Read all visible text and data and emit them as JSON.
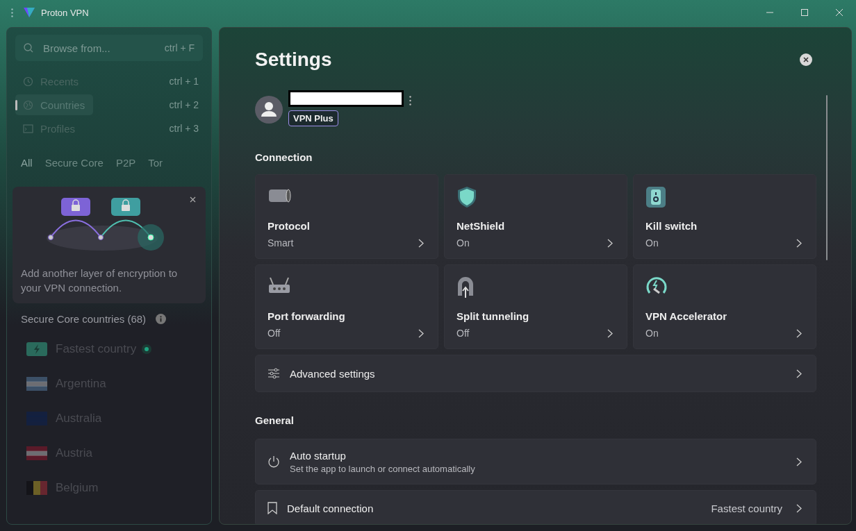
{
  "window": {
    "title": "Proton VPN"
  },
  "sidebar": {
    "search": {
      "placeholder": "Browse from...",
      "shortcut": "ctrl + F"
    },
    "nav": [
      {
        "label": "Recents",
        "shortcut": "ctrl + 1",
        "selected": false
      },
      {
        "label": "Countries",
        "shortcut": "ctrl + 2",
        "selected": true
      },
      {
        "label": "Profiles",
        "shortcut": "ctrl + 3",
        "selected": false
      }
    ],
    "filters": [
      {
        "label": "All",
        "selected": true
      },
      {
        "label": "Secure Core",
        "selected": false
      },
      {
        "label": "P2P",
        "selected": false
      },
      {
        "label": "Tor",
        "selected": false
      }
    ],
    "promo": {
      "text": "Add another layer of encryption to your VPN connection."
    },
    "list_heading": "Secure Core countries (68)",
    "countries": [
      {
        "kind": "fastest",
        "name": "Fastest country",
        "connected": true
      },
      {
        "kind": "country",
        "name": "Argentina"
      },
      {
        "kind": "country",
        "name": "Australia"
      },
      {
        "kind": "country",
        "name": "Austria"
      },
      {
        "kind": "country",
        "name": "Belgium"
      }
    ]
  },
  "settings": {
    "title": "Settings",
    "account": {
      "plan": "VPN Plus"
    },
    "connection_heading": "Connection",
    "cards": [
      {
        "title": "Protocol",
        "value": "Smart"
      },
      {
        "title": "NetShield",
        "value": "On"
      },
      {
        "title": "Kill switch",
        "value": "On"
      },
      {
        "title": "Port forwarding",
        "value": "Off"
      },
      {
        "title": "Split tunneling",
        "value": "Off"
      },
      {
        "title": "VPN Accelerator",
        "value": "On"
      }
    ],
    "advanced": {
      "label": "Advanced settings"
    },
    "general_heading": "General",
    "general": [
      {
        "label": "Auto startup",
        "description": "Set the app to launch or connect automatically"
      },
      {
        "label": "Default connection",
        "value": "Fastest country"
      }
    ]
  }
}
